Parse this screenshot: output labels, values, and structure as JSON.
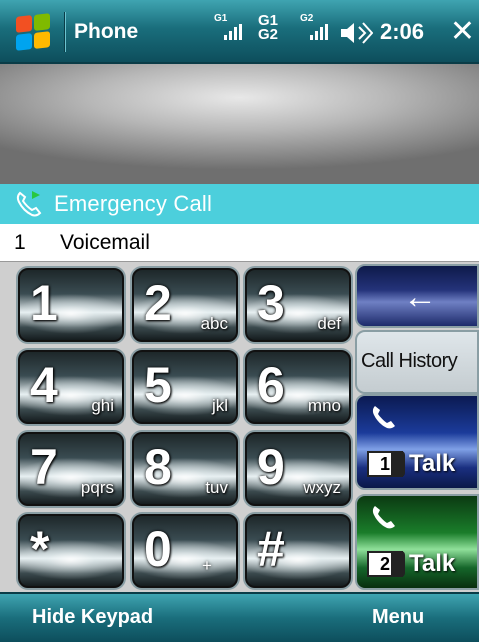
{
  "titlebar": {
    "app_title": "Phone",
    "signal_1": "G1",
    "signal_g1g2_top": "G1",
    "signal_g1g2_bottom": "G2",
    "signal_3": "G2",
    "time": "2:06",
    "close_glyph": "✕"
  },
  "list": {
    "emergency_label": "Emergency Call",
    "voicemail_number": "1",
    "voicemail_label": "Voicemail"
  },
  "keypad": {
    "keys": [
      {
        "digit": "1",
        "letters": ""
      },
      {
        "digit": "2",
        "letters": "abc"
      },
      {
        "digit": "3",
        "letters": "def"
      },
      {
        "digit": "4",
        "letters": "ghi"
      },
      {
        "digit": "5",
        "letters": "jkl"
      },
      {
        "digit": "6",
        "letters": "mno"
      },
      {
        "digit": "7",
        "letters": "pqrs"
      },
      {
        "digit": "8",
        "letters": "tuv"
      },
      {
        "digit": "9",
        "letters": "wxyz"
      },
      {
        "digit": "*",
        "letters": ""
      },
      {
        "digit": "0",
        "letters": "+"
      },
      {
        "digit": "#",
        "letters": ""
      }
    ]
  },
  "side_buttons": {
    "backspace_glyph": "←",
    "call_history_label": "Call History",
    "talk1_line": "1",
    "talk1_label": "Talk",
    "talk2_line": "2",
    "talk2_label": "Talk"
  },
  "menubar": {
    "left_softkey": "Hide Keypad",
    "right_softkey": "Menu"
  },
  "colors": {
    "titlebar": "#1a6e7c",
    "highlight_row": "#4ccfdc",
    "talk1": "#1b3b9a",
    "talk2": "#1a7d2a"
  },
  "icons": {
    "start": "windows-logo-icon",
    "volume": "speaker-icon",
    "emergency": "phone-icon",
    "talk": "phone-handset-icon"
  }
}
